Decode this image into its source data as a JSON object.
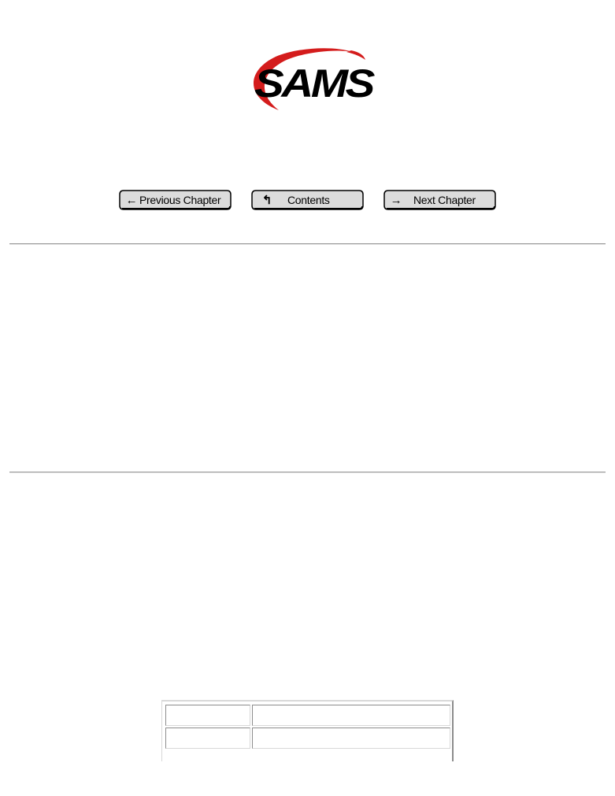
{
  "logo": {
    "text": "SAMS",
    "swoosh_color": "#d41c1c",
    "text_color": "#000000"
  },
  "nav": {
    "previous": {
      "label": "Previous Chapter",
      "icon": "arrow-left-icon"
    },
    "contents": {
      "label": "Contents",
      "icon": "arrow-up-icon"
    },
    "next": {
      "label": "Next Chapter",
      "icon": "arrow-right-icon"
    }
  },
  "colors": {
    "button_fill": "#dcdcdc",
    "button_border": "#000000",
    "rule": "#9a9a9a"
  },
  "table": {
    "rows": [
      [
        "",
        ""
      ],
      [
        "",
        ""
      ]
    ]
  }
}
